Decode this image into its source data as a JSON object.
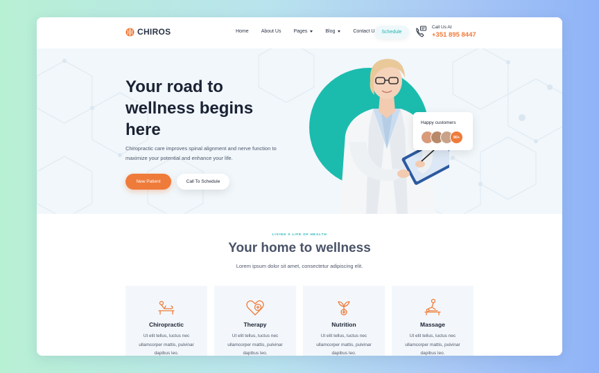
{
  "brand": {
    "name": "CHIROS",
    "accent": "#ef7b3a",
    "teal": "#1bbcae"
  },
  "nav": {
    "items": [
      {
        "label": "Home"
      },
      {
        "label": "About Us"
      },
      {
        "label": "Pages",
        "dropdown": true
      },
      {
        "label": "Blog",
        "dropdown": true
      },
      {
        "label": "Contact Us"
      }
    ],
    "schedule_label": "Schedule"
  },
  "call": {
    "label": "Call Us At",
    "number": "+351 895 8447"
  },
  "hero": {
    "title": "Your road to wellness begins here",
    "description": "Chiropractic care improves spinal alignment and nerve function to maximize your potential and enhance your life.",
    "primary_button": "New Patient",
    "secondary_button": "Call To Schedule",
    "happy_label": "Happy customers",
    "happy_count": "90+"
  },
  "section": {
    "eyebrow": "LIVING A LIFE OF HEALTH",
    "title": "Your home to wellness",
    "subtitle": "Lorem ipsum dolor sit amet, consectetur adipiscing elit.",
    "cards": [
      {
        "title": "Chiropractic",
        "text": "Ut elit tellus, luctus nec ullamcorper mattis, pulvinar dapibus leo.",
        "icon": "chiropractic-bed-icon"
      },
      {
        "title": "Therapy",
        "text": "Ut elit tellus, luctus nec ullamcorper mattis, pulvinar dapibus leo.",
        "icon": "heart-brain-icon"
      },
      {
        "title": "Nutrition",
        "text": "Ut elit tellus, luctus nec ullamcorper mattis, pulvinar dapibus leo.",
        "icon": "plant-icon"
      },
      {
        "title": "Massage",
        "text": "Ut elit tellus, luctus nec ullamcorper mattis, pulvinar dapibus leo.",
        "icon": "massage-icon"
      }
    ]
  }
}
